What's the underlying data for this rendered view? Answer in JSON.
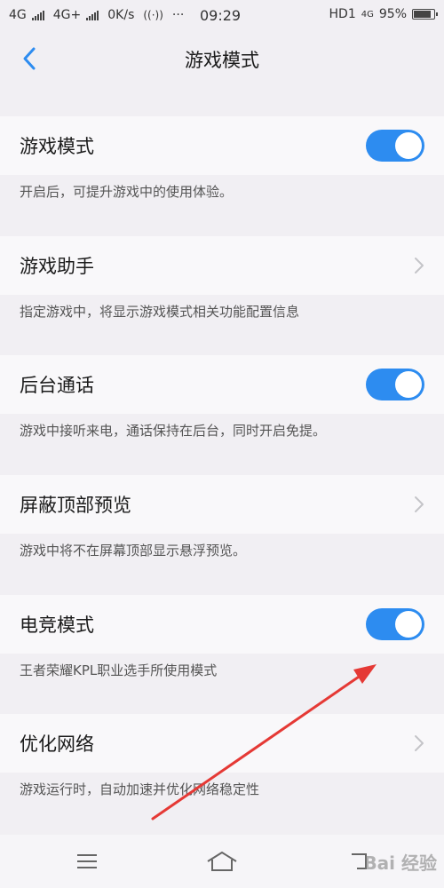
{
  "status_bar": {
    "net1": "4G",
    "net2": "4G+",
    "speed": "0K/s",
    "dots": "···",
    "time": "09:29",
    "hd": "HD1",
    "net3": "4G",
    "battery": "95%"
  },
  "header": {
    "title": "游戏模式",
    "back_icon": "chevron-left-icon"
  },
  "settings": [
    {
      "label": "游戏模式",
      "control": "toggle",
      "on": true,
      "desc": "开启后，可提升游戏中的使用体验。"
    },
    {
      "label": "游戏助手",
      "control": "chevron",
      "desc": "指定游戏中，将显示游戏模式相关功能配置信息"
    },
    {
      "label": "后台通话",
      "control": "toggle",
      "on": true,
      "desc": "游戏中接听来电，通话保持在后台，同时开启免提。"
    },
    {
      "label": "屏蔽顶部预览",
      "control": "chevron",
      "desc": "游戏中将不在屏幕顶部显示悬浮预览。"
    },
    {
      "label": "电竞模式",
      "control": "toggle",
      "on": true,
      "desc": "王者荣耀KPL职业选手所使用模式"
    },
    {
      "label": "优化网络",
      "control": "chevron",
      "desc": "游戏运行时，自动加速并优化网络稳定性"
    }
  ],
  "colors": {
    "accent": "#2d8cf0",
    "background": "#f1eff3",
    "row": "#f9f8fa",
    "annotation_arrow": "#e53935"
  },
  "bottom_nav": {
    "menu_icon": "menu-icon",
    "home_icon": "home-icon",
    "back_icon": "back-icon"
  },
  "watermark": "Bai 经验"
}
